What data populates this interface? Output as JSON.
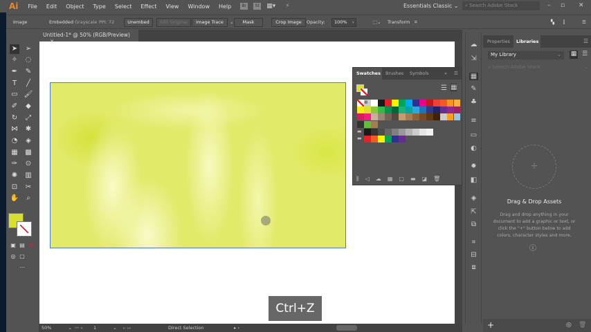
{
  "app": {
    "logo": "Ai",
    "menu": [
      "File",
      "Edit",
      "Object",
      "Type",
      "Select",
      "Effect",
      "View",
      "Window",
      "Help"
    ],
    "bridge": "Br",
    "stock_btn": "St",
    "workspace": "Essentials Classic",
    "search_placeholder": "Search Adobe Stock"
  },
  "control": {
    "selection": "Image",
    "embedded": "Embedded",
    "mode": "Grayscale",
    "ppi": "PPI: 72",
    "unembed": "Unembed",
    "edit_original": "Edit Original",
    "image_trace": "Image Trace",
    "mask": "Mask",
    "crop": "Crop Image",
    "opacity_label": "Opacity:",
    "opacity": "100%",
    "transform": "Transform"
  },
  "document": {
    "tab": "Untitled-1* @ 50% (RGB/Preview)",
    "close": "×"
  },
  "swatches": {
    "tabs": [
      "Swatches",
      "Brushes",
      "Symbols"
    ],
    "fill_color": "#d9e02a",
    "rows": [
      [
        "none",
        "reg",
        "#ffffff",
        "#1a1a1a",
        "#e62129",
        "#fff200",
        "#00a651",
        "#00aeef",
        "#2e3192",
        "#ec008c",
        "#c4161c",
        "#ef4136",
        "#f15a24",
        "#f7941d",
        "#fbb040"
      ],
      [
        "#f7ec13",
        "#d9e02a",
        "#8dc63f",
        "#39b54a",
        "#009444",
        "#006838",
        "#1bb178",
        "#00a79d",
        "#27aae1",
        "#1c75bc",
        "#2b3990",
        "#262262",
        "#662d91",
        "#92278f",
        "#9e1f63"
      ],
      [
        "#d91c5c",
        "#ed217c",
        "#c7b299",
        "#998675",
        "#736357",
        "#534741",
        "#c69c6d",
        "#a67c52",
        "#8c6239",
        "#754c24",
        "#603913",
        "#42210b",
        "#cccccc",
        "#f9a01b",
        "#9bc4e2"
      ],
      [
        "#333333",
        "#5fbf3a",
        "#a67c52"
      ],
      [
        "folder",
        "#1a1a1a",
        "#333333",
        "#4d4d4d",
        "#666666",
        "#808080",
        "#999999",
        "#b3b3b3",
        "#cccccc",
        "#e6e6e6",
        "#f2f2f2"
      ],
      [
        "folder",
        "#e62129",
        "#f15a24",
        "#fff200",
        "#00a651",
        "#2e3192",
        "#662d91"
      ]
    ]
  },
  "libraries": {
    "tabs": [
      "Properties",
      "Libraries"
    ],
    "library": "My Library",
    "search_placeholder": "Search Adobe Stock",
    "heading": "Drag & Drop Assets",
    "body": "Drag and drop anything in your document to add a graphic or text, or click the \"+\" button below to add colors, character styles and more.",
    "add": "+"
  },
  "status": {
    "zoom": "50%",
    "artboard": "1",
    "tool": "Direct Selection"
  },
  "overlay": {
    "keys": "Ctrl+Z"
  }
}
